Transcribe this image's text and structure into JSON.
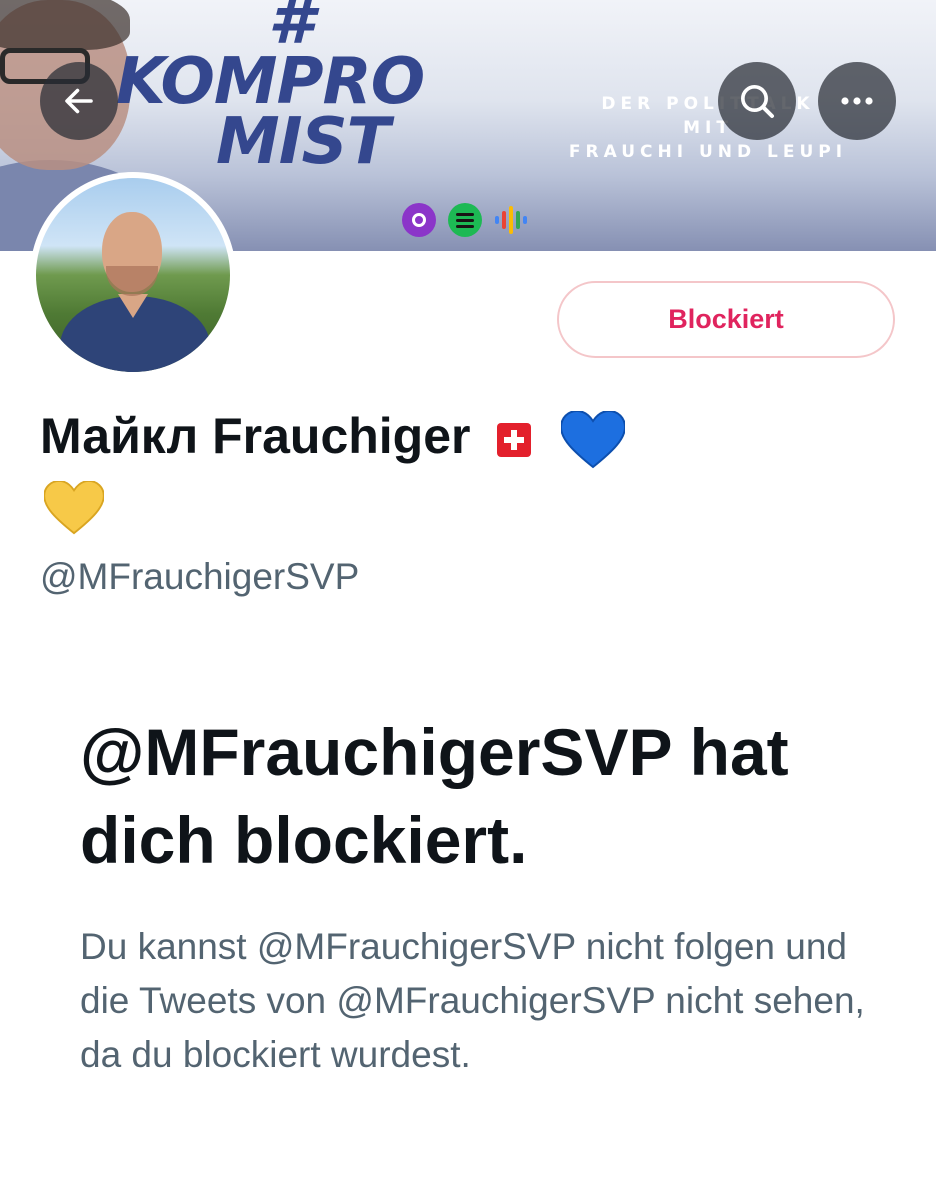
{
  "banner": {
    "hashtag": "#",
    "title_line1": "KOMPRO",
    "title_line2": "MIST",
    "subtitle_line1": "DER POLITTALK",
    "subtitle_line2": "MIT",
    "subtitle_line3": "FRAUCHI UND LEUPI"
  },
  "header": {
    "back_icon": "arrow-left-icon",
    "search_icon": "search-icon",
    "more_icon": "more-horizontal-icon"
  },
  "profile": {
    "name": "Майкл Frauchiger",
    "handle": "@MFrauchigerSVP",
    "blocked_button_label": "Blockiert"
  },
  "blocked_notice": {
    "title": "@MFrauchigerSVP hat dich blockiert.",
    "description": "Du kannst @MFrauchigerSVP nicht folgen und die Tweets von @MFrauchigerSVP nicht sehen, da du blockiert wurdest."
  },
  "colors": {
    "blocked_red": "#e0245e",
    "banner_text": "#34478e",
    "secondary_text": "#536471"
  }
}
